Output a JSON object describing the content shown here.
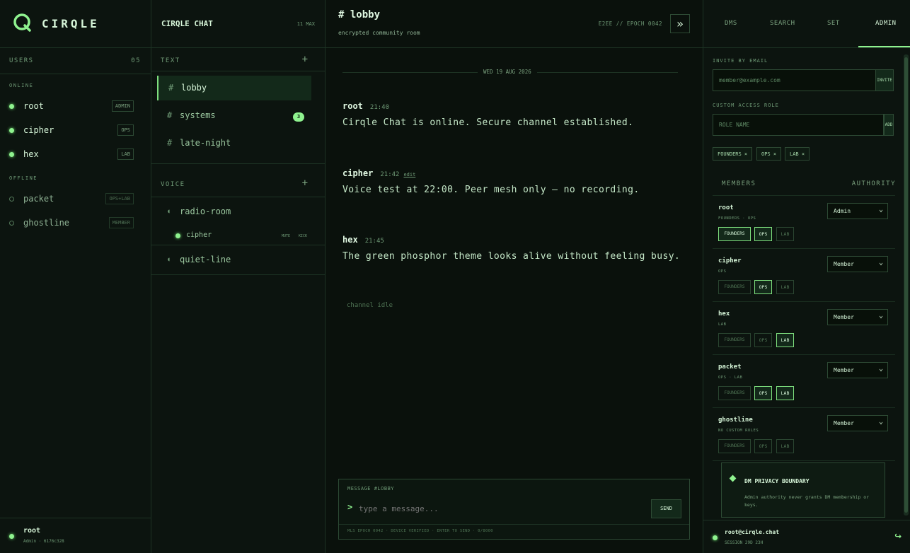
{
  "brand": "CIRQLE",
  "users": {
    "title": "USERS",
    "count": "05",
    "online_label": "ONLINE",
    "offline_label": "OFFLINE",
    "online": [
      {
        "name": "root",
        "tag": "ADMIN"
      },
      {
        "name": "cipher",
        "tag": "OPS"
      },
      {
        "name": "hex",
        "tag": "LAB"
      }
    ],
    "offline": [
      {
        "name": "packet",
        "tag": "OPS+LAB"
      },
      {
        "name": "ghostline",
        "tag": "MEMBER"
      }
    ]
  },
  "self": {
    "name": "root",
    "sub": "Admin · 6176c328"
  },
  "server": {
    "name": "CIRQLE CHAT",
    "max": "11 MAX"
  },
  "text": {
    "label": "TEXT",
    "channels": [
      {
        "name": "lobby"
      },
      {
        "name": "systems",
        "unread": "3"
      },
      {
        "name": "late-night"
      }
    ]
  },
  "voice": {
    "label": "VOICE",
    "rooms": [
      "radio-room",
      "quiet-line"
    ],
    "participant": "cipher",
    "mute": "MUTE",
    "kick": "KICK"
  },
  "channel": {
    "title": "# lobby",
    "subtitle": "encrypted community room",
    "meta": "E2EE // EPOCH 0042",
    "date": "WED 19 AUG 2026",
    "idle": "channel idle"
  },
  "messages": [
    {
      "author": "root",
      "time": "21:40",
      "text": "Cirqle Chat is online. Secure channel established."
    },
    {
      "author": "cipher",
      "time": "21:42",
      "edit": "edit",
      "text": "Voice test at 22:00. Peer mesh only — no recording."
    },
    {
      "author": "hex",
      "time": "21:45",
      "text": "The green phosphor theme looks alive without feeling busy."
    }
  ],
  "composer": {
    "label": "MESSAGE #LOBBY",
    "prompt": ">",
    "placeholder": "type a message...",
    "send": "SEND",
    "footer": "MLS EPOCH 0042 · DEVICE VERIFIED · ENTER TO SEND · 0/8000"
  },
  "tabs": [
    "DMS",
    "SEARCH",
    "SET",
    "ADMIN"
  ],
  "admin": {
    "invite_label": "INVITE BY EMAIL",
    "invite_placeholder": "member@example.com",
    "invite_btn": "INVITE",
    "role_label": "CUSTOM ACCESS ROLE",
    "role_placeholder": "ROLE NAME",
    "role_btn": "ADD",
    "chips": [
      "FOUNDERS ×",
      "OPS ×",
      "LAB ×"
    ],
    "members_label": "MEMBERS",
    "authority_label": "AUTHORITY",
    "role_names": [
      "FOUNDERS",
      "OPS",
      "LAB"
    ],
    "members": [
      {
        "name": "root",
        "sub": "FOUNDERS · OPS",
        "authority": "Admin",
        "roles": [
          true,
          true,
          false
        ]
      },
      {
        "name": "cipher",
        "sub": "OPS",
        "authority": "Member",
        "roles": [
          false,
          true,
          false
        ]
      },
      {
        "name": "hex",
        "sub": "LAB",
        "authority": "Member",
        "roles": [
          false,
          false,
          true
        ]
      },
      {
        "name": "packet",
        "sub": "OPS · LAB",
        "authority": "Member",
        "roles": [
          false,
          true,
          true
        ]
      },
      {
        "name": "ghostline",
        "sub": "NO CUSTOM ROLES",
        "authority": "Member",
        "roles": [
          false,
          false,
          false
        ]
      }
    ],
    "privacy_title": "DM PRIVACY BOUNDARY",
    "privacy_text": "Admin authority never grants DM membership or keys."
  },
  "session": {
    "user": "root@cirqle.chat",
    "expiry": "SESSION 29D 23H"
  },
  "colors": {
    "accent": "#8ff28f",
    "bg": "#0b130e",
    "border": "#1d3324"
  }
}
